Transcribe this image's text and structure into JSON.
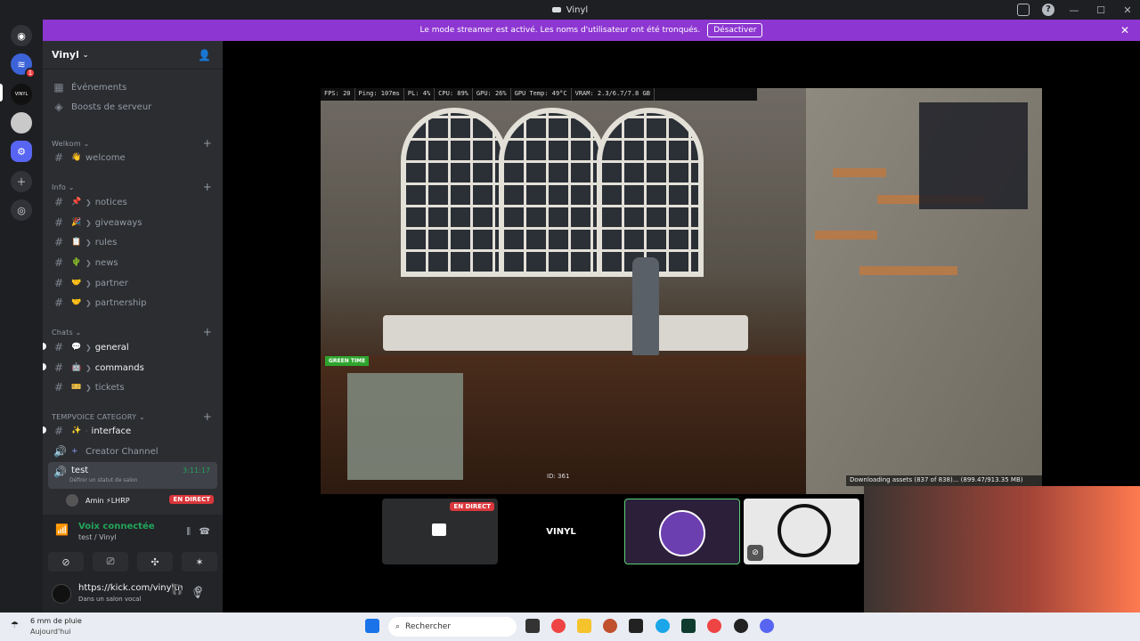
{
  "window": {
    "title": "Vinyl"
  },
  "banner": {
    "text": "Le mode streamer est activé. Les noms d'utilisateur ont été tronqués.",
    "button": "Désactiver"
  },
  "rail": {
    "badge_count": "1"
  },
  "server": {
    "name": "Vinyl"
  },
  "sidebar": {
    "events": "Événements",
    "boosts": "Boosts de serveur",
    "categories": {
      "welkom": "Welkom",
      "info": "Info",
      "chats": "Chats",
      "tempvoice": "TEMPVOICE CATEGORY"
    },
    "channels": {
      "welcome": "welcome",
      "notices": "notices",
      "giveaways": "giveaways",
      "rules": "rules",
      "news": "news",
      "partner": "partner",
      "partnership": "partnership",
      "general": "general",
      "commands": "commands",
      "tickets": "tickets",
      "interface": "interface",
      "creator": "Creator Channel",
      "test": "test",
      "test_time": "3:11:17",
      "test_status": "Définir un statut de salon",
      "member": "Amin ⚡LHRP",
      "member_live": "EN DIRECT"
    }
  },
  "voice": {
    "status": "Voix connectée",
    "channel": "test / Vinyl"
  },
  "user": {
    "name": "https://kick.com/vinyltn",
    "status": "Dans un salon vocal"
  },
  "game": {
    "hud": [
      "FPS: 20",
      "Ping: 107ms",
      "PL: 4%",
      "CPU: 89%",
      "GPU: 26%",
      "GPU Temp: 49°C",
      "VRAM: 2.3/6.7/7.8 GB"
    ],
    "green_time": "GREEN TIME",
    "id": "ID: 361",
    "download": "Downloading assets (837 of 838)... (899.47/913.35 MB)"
  },
  "tiles": {
    "live": "EN DIRECT",
    "vinyl": "VINYL"
  },
  "taskbar": {
    "weather": "6 mm de pluie",
    "day": "Aujourd'hui",
    "search": "Rechercher"
  }
}
